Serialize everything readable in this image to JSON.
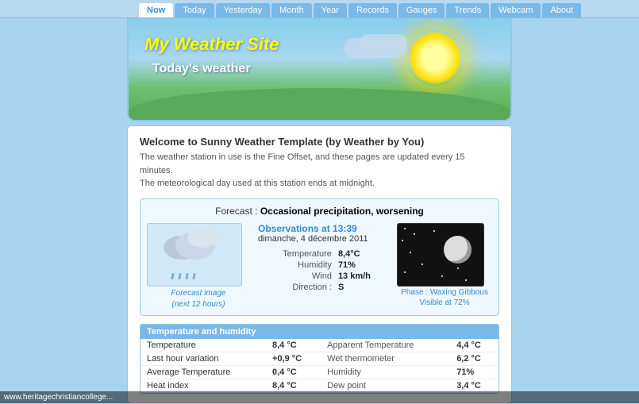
{
  "nav": {
    "items": [
      {
        "label": "Now",
        "active": true
      },
      {
        "label": "Today",
        "active": false
      },
      {
        "label": "Yesterday",
        "active": false
      },
      {
        "label": "Month",
        "active": false
      },
      {
        "label": "Year",
        "active": false
      },
      {
        "label": "Records",
        "active": false
      },
      {
        "label": "Gauges",
        "active": false
      },
      {
        "label": "Trends",
        "active": false
      },
      {
        "label": "Webcam",
        "active": false
      },
      {
        "label": "About",
        "active": false
      }
    ]
  },
  "header": {
    "title": "My Weather Site",
    "subtitle": "Today's weather"
  },
  "welcome": {
    "title": "Welcome to Sunny Weather Template (by Weather by You)",
    "line1": "The weather station in use is the Fine Offset, and these pages are updated every 15 minutes.",
    "line2": "The meteorological day used at this station ends at midnight."
  },
  "forecast": {
    "label": "Forecast :",
    "description": "Occasional precipitation, worsening",
    "image_label": "Forecast image",
    "image_sublabel": "(next 12 hours)",
    "observations_title": "Observations at 13:39",
    "observations_date": "dimanche, 4 décembre 2011",
    "rows": [
      {
        "label": "Temperature",
        "value": "8,4°C"
      },
      {
        "label": "Humidity",
        "value": "71%"
      },
      {
        "label": "Wind",
        "value": "13 km/h"
      },
      {
        "label": "Direction :",
        "value": "S"
      }
    ],
    "moon_label": "Phase : Waxing Gibbous",
    "moon_sublabel": "Visible at 72%"
  },
  "temp_table": {
    "header": "Temperature and humidity",
    "rows": [
      {
        "col1_label": "Temperature",
        "col1_val": "8,4 °C",
        "col2_label": "Apparent Temperature",
        "col2_val": "4,4 °C"
      },
      {
        "col1_label": "Last hour variation",
        "col1_val": "+0,9 °C",
        "col2_label": "Wet thermometer",
        "col2_val": "6,2 °C"
      },
      {
        "col1_label": "Average Temperature",
        "col1_val": "0,4 °C",
        "col2_label": "Humidity",
        "col2_val": "71%"
      },
      {
        "col1_label": "Heat index",
        "col1_val": "8,4 °C",
        "col2_label": "Dew point",
        "col2_val": "3,4 °C"
      }
    ]
  },
  "footer": {
    "url": "www.heritagechristiancollege..."
  }
}
